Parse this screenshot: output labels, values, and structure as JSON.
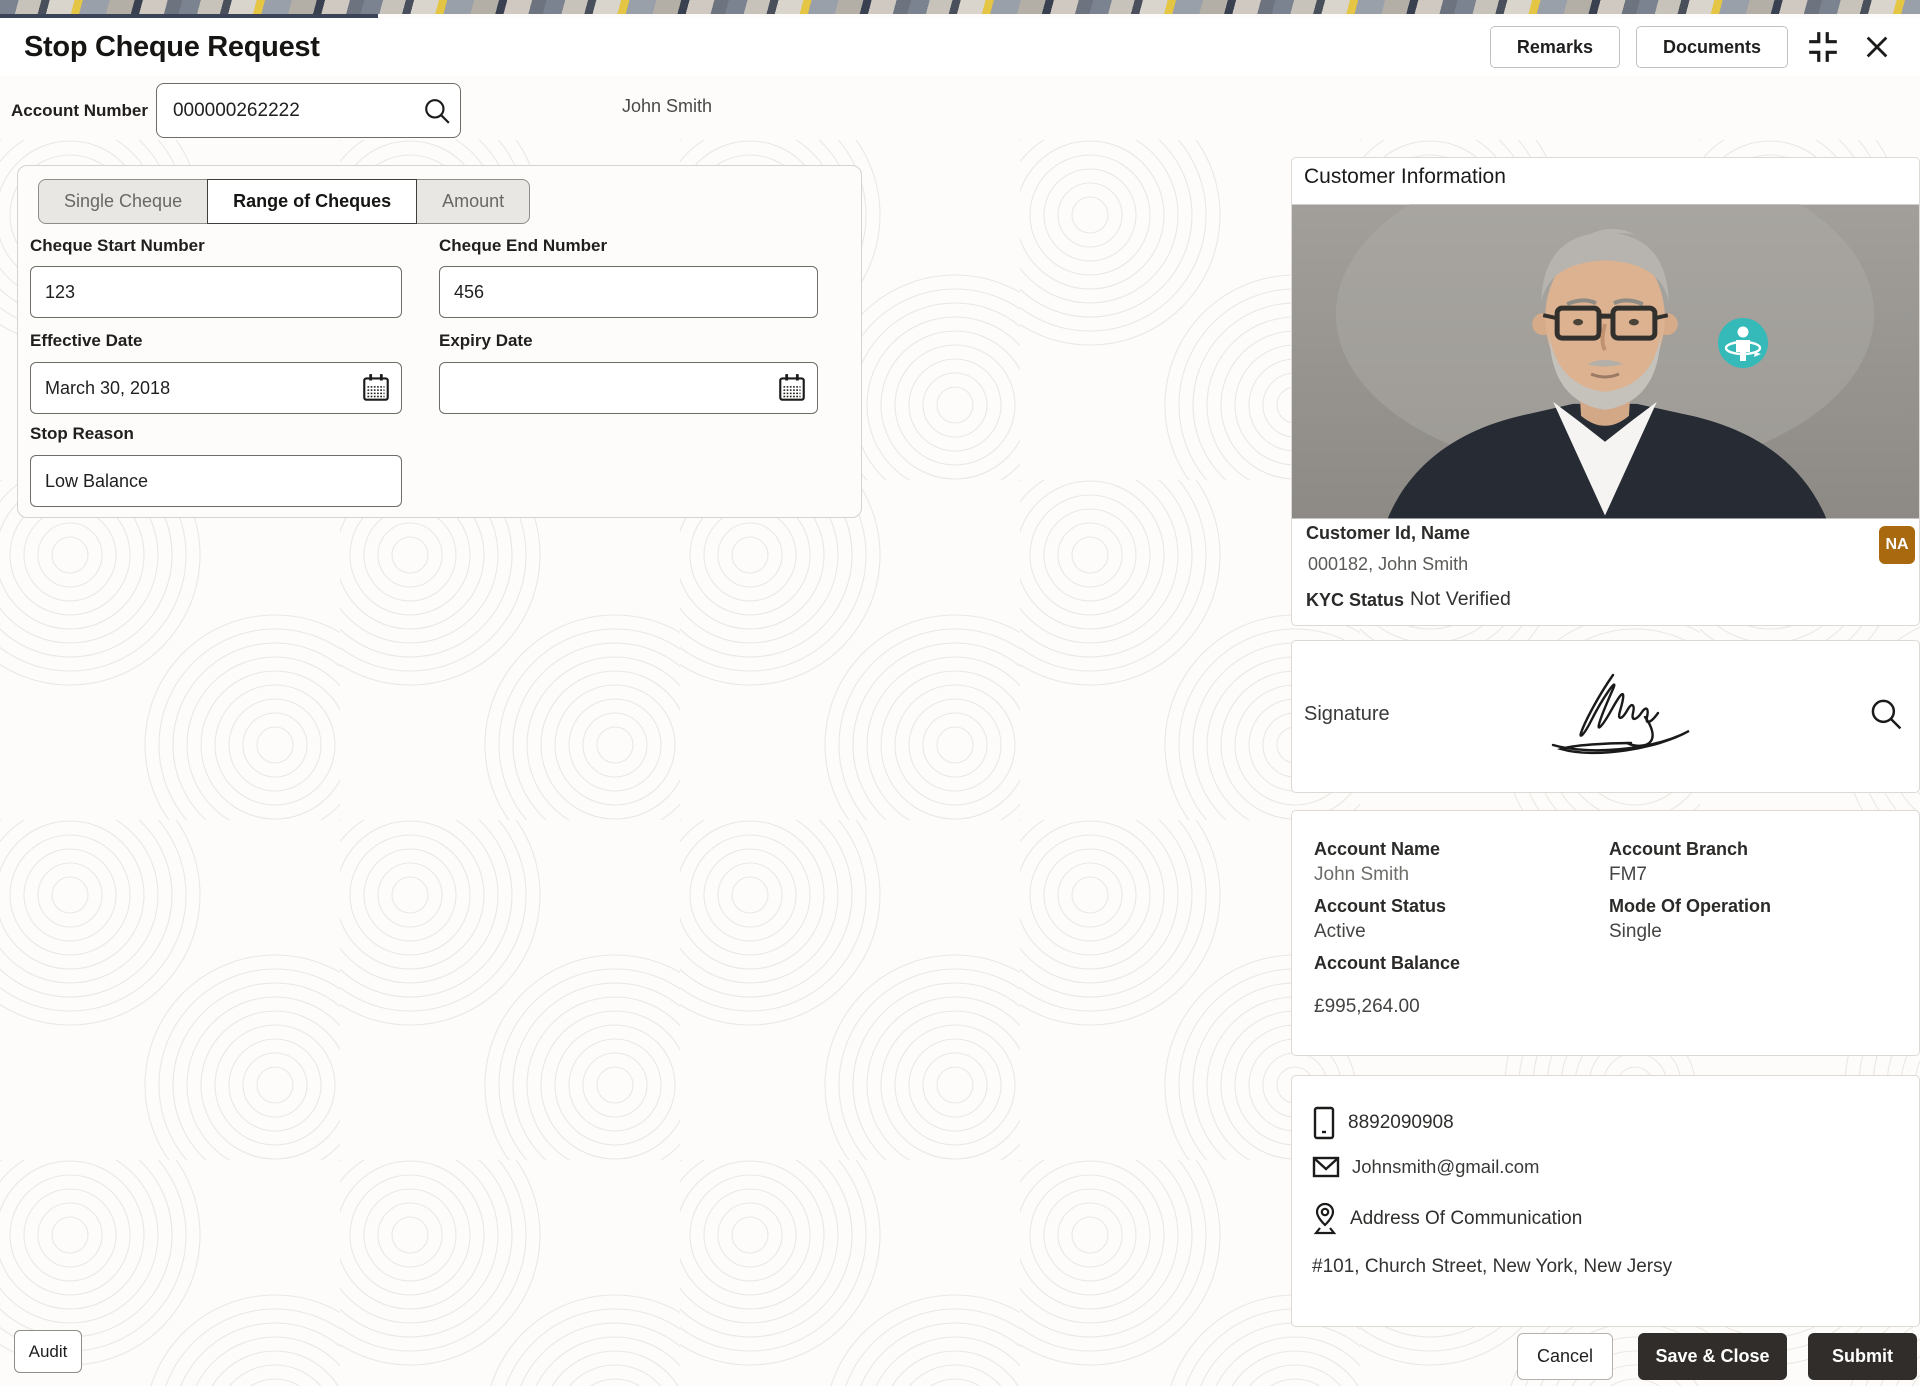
{
  "header": {
    "title": "Stop Cheque Request",
    "remarks_label": "Remarks",
    "documents_label": "Documents"
  },
  "account_lookup": {
    "label": "Account Number",
    "value": "000000262222",
    "customer_name": "John Smith"
  },
  "tabs": [
    {
      "label": "Single Cheque",
      "active": false
    },
    {
      "label": "Range of Cheques",
      "active": true
    },
    {
      "label": "Amount",
      "active": false
    }
  ],
  "form": {
    "cheque_start": {
      "label": "Cheque Start Number",
      "value": "123"
    },
    "cheque_end": {
      "label": "Cheque End Number",
      "value": "456"
    },
    "effective_date": {
      "label": "Effective Date",
      "value": "March 30, 2018"
    },
    "expiry_date": {
      "label": "Expiry Date",
      "value": ""
    },
    "stop_reason": {
      "label": "Stop Reason",
      "value": "Low Balance"
    }
  },
  "customer_info": {
    "heading": "Customer Information",
    "id_name_label": "Customer Id, Name",
    "id_name_value": "000182, John Smith",
    "kyc_label": "KYC Status",
    "kyc_value": "Not Verified",
    "badge": "NA",
    "signature_label": "Signature"
  },
  "account_details": {
    "fields": [
      {
        "label": "Account Name",
        "value": "John Smith"
      },
      {
        "label": "Account Branch",
        "value": "FM7"
      },
      {
        "label": "Account Status",
        "value": "Active"
      },
      {
        "label": "Mode Of Operation",
        "value": "Single"
      },
      {
        "label": "Account Balance",
        "value": "£995,264.00"
      }
    ]
  },
  "contact": {
    "phone": "8892090908",
    "email": "Johnsmith@gmail.com",
    "address_label": "Address Of Communication",
    "address": "#101, Church Street, New York, New Jersy"
  },
  "footer": {
    "audit_label": "Audit",
    "cancel_label": "Cancel",
    "save_close_label": "Save & Close",
    "submit_label": "Submit"
  },
  "colors": {
    "accent_teal": "#35B9B9",
    "na_badge_bg": "#A8690F",
    "primary_button_bg": "#312D2A",
    "strip_yellow": "#E5C544"
  }
}
